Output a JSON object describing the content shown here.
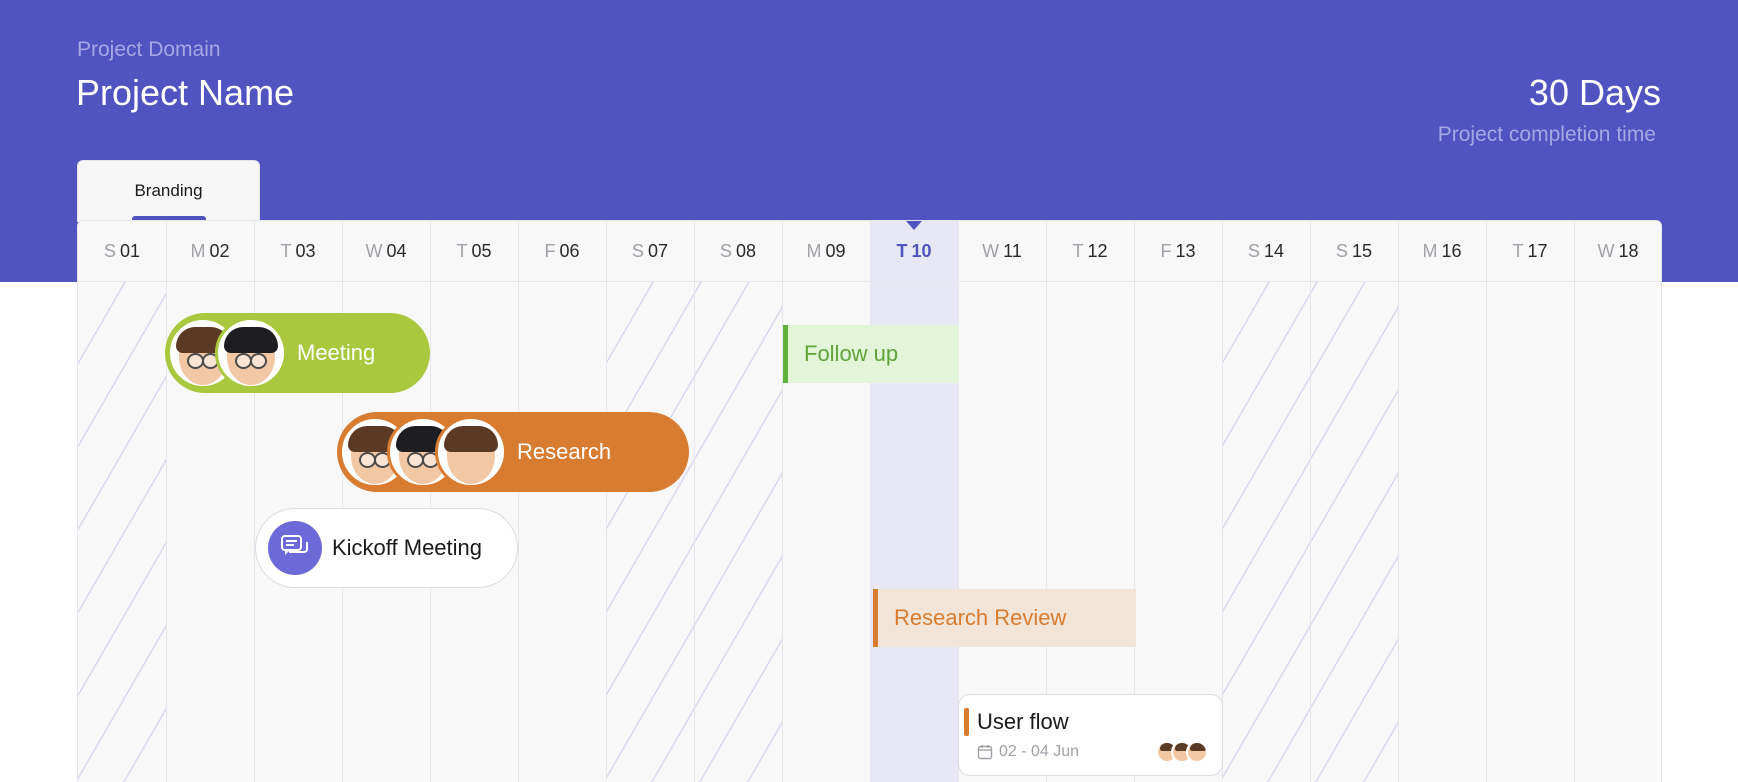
{
  "header": {
    "domain": "Project Domain",
    "project_name": "Project Name",
    "duration": "30 Days",
    "duration_label": "Project completion time"
  },
  "tabs": [
    {
      "label": "Branding",
      "active": true
    }
  ],
  "colors": {
    "brand": "#5054c0",
    "meeting": "#a9c83e",
    "research": "#d87c31",
    "follow_up": "#5fb33a",
    "kickoff_icon": "#6c6ad8"
  },
  "days": [
    {
      "letter": "S",
      "num": "01"
    },
    {
      "letter": "M",
      "num": "02"
    },
    {
      "letter": "T",
      "num": "03"
    },
    {
      "letter": "W",
      "num": "04"
    },
    {
      "letter": "T",
      "num": "05"
    },
    {
      "letter": "F",
      "num": "06"
    },
    {
      "letter": "S",
      "num": "07"
    },
    {
      "letter": "S",
      "num": "08"
    },
    {
      "letter": "M",
      "num": "09"
    },
    {
      "letter": "T",
      "num": "10"
    },
    {
      "letter": "W",
      "num": "11"
    },
    {
      "letter": "T",
      "num": "12"
    },
    {
      "letter": "F",
      "num": "13"
    },
    {
      "letter": "S",
      "num": "14"
    },
    {
      "letter": "S",
      "num": "15"
    },
    {
      "letter": "M",
      "num": "16"
    },
    {
      "letter": "T",
      "num": "17"
    },
    {
      "letter": "W",
      "num": "18"
    }
  ],
  "today_index": 9,
  "events": {
    "meeting": {
      "label": "Meeting",
      "avatars": [
        "avatar-brown-hair",
        "avatar-glasses"
      ]
    },
    "research": {
      "label": "Research",
      "avatars": [
        "avatar-brown-hair",
        "avatar-glasses",
        "avatar-man"
      ]
    },
    "kickoff": {
      "label": "Kickoff Meeting",
      "icon": "chat-icon"
    },
    "follow_up": {
      "label": "Follow up"
    },
    "research_review": {
      "label": "Research Review"
    },
    "user_flow": {
      "label": "User flow",
      "date": "02 - 04 Jun",
      "icon": "calendar-icon"
    }
  }
}
